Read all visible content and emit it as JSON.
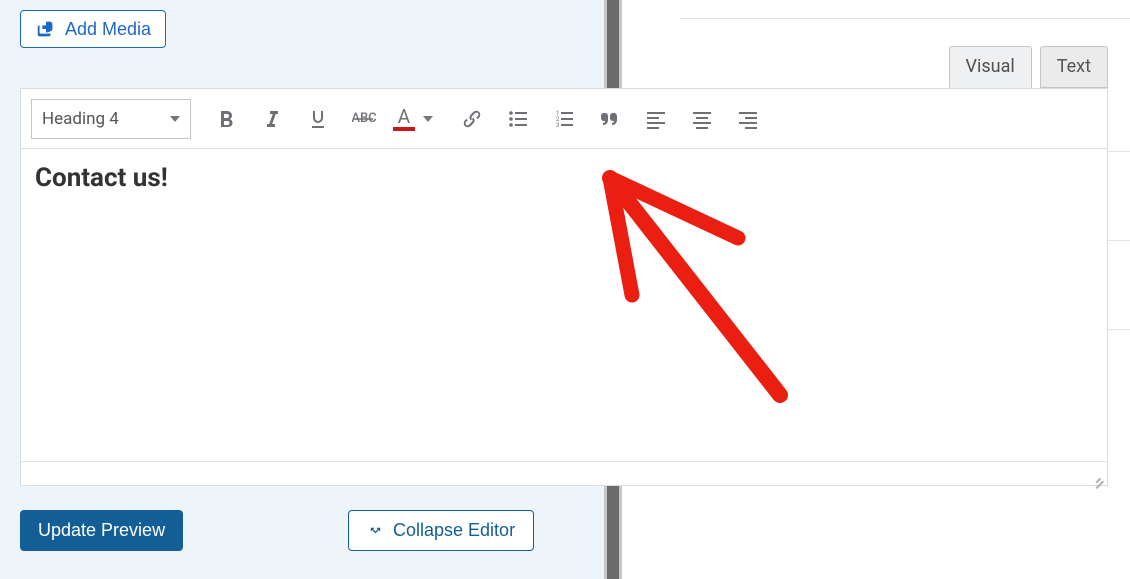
{
  "buttons": {
    "add_media": "Add Media",
    "update_preview": "Update Preview",
    "collapse_editor": "Collapse Editor"
  },
  "tabs": {
    "visual": "Visual",
    "text": "Text"
  },
  "toolbar": {
    "format_label": "Heading 4",
    "text_color": "#c8171f"
  },
  "editor": {
    "content_heading": "Contact us!"
  },
  "icons": {
    "media": "media-icon",
    "bold": "bold-icon",
    "italic": "italic-icon",
    "underline": "underline-icon",
    "strike": "strikethrough-icon",
    "color": "text-color-icon",
    "link": "link-icon",
    "ul": "bulleted-list-icon",
    "ol": "numbered-list-icon",
    "quote": "blockquote-icon",
    "align_left": "align-left-icon",
    "align_center": "align-center-icon",
    "align_right": "align-right-icon",
    "collapse": "collapse-icon",
    "dropdown": "chevron-down-icon"
  }
}
